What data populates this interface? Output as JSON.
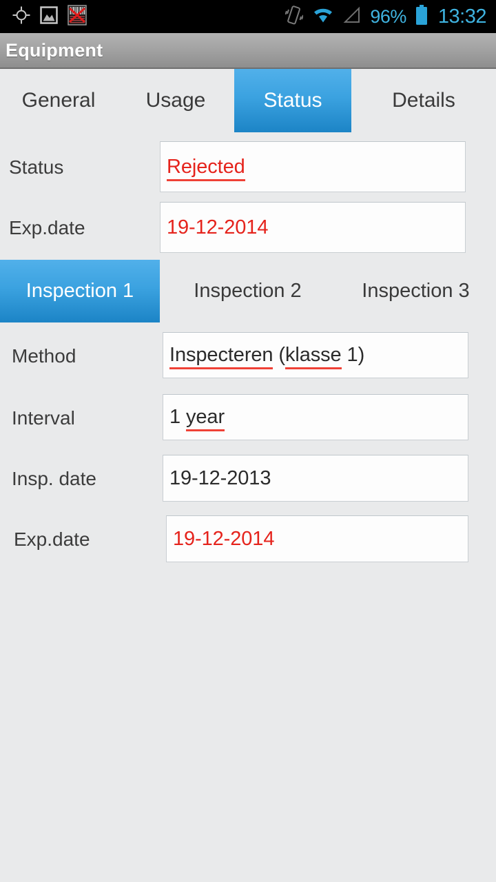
{
  "statusbar": {
    "icons_left": [
      "gps-location-icon",
      "gallery-image-icon",
      "barcode-disabled-icon"
    ],
    "icons_right": [
      "vibrate-icon",
      "wifi-icon",
      "signal-icon",
      "battery-icon"
    ],
    "battery_percent": "96%",
    "clock": "13:32"
  },
  "titlebar": {
    "title": "Equipment"
  },
  "tabs": [
    {
      "label": "General",
      "active": false
    },
    {
      "label": "Usage",
      "active": false
    },
    {
      "label": "Status",
      "active": true
    },
    {
      "label": "Details",
      "active": false
    }
  ],
  "status_section": {
    "status": {
      "label": "Status",
      "value": "Rejected",
      "value_color": "#e5231c",
      "spellcheck_underline": true
    },
    "exp_date": {
      "label": "Exp.date",
      "value": "19-12-2014",
      "value_color": "#e5231c",
      "spellcheck_underline": false
    }
  },
  "inspection_tabs": [
    {
      "label": "Inspection 1",
      "active": true
    },
    {
      "label": "Inspection 2",
      "active": false
    },
    {
      "label": "Inspection 3",
      "active": false
    }
  ],
  "inspection_fields": {
    "method": {
      "label": "Method",
      "value_part1": "Inspecteren",
      "value_part2": " (",
      "value_part3": "klasse",
      "value_part4": " 1)",
      "value_full": "Inspecteren (klasse 1)",
      "value_color": "#2b2b2b"
    },
    "interval": {
      "label": "Interval",
      "value_part1": "1 ",
      "value_part2": "year",
      "value_full": "1 year",
      "value_color": "#2b2b2b"
    },
    "insp_date": {
      "label": "Insp. date",
      "value": "19-12-2013",
      "value_color": "#2b2b2b"
    },
    "exp_date": {
      "label": "Exp.date",
      "value": "19-12-2014",
      "value_color": "#e5231c"
    }
  },
  "colors": {
    "accent_blue": "#1c84c6",
    "tab_blue_light": "#51b0ea",
    "error_red": "#e5231c",
    "spell_underline_red": "#ef4136",
    "page_background": "#e9eaeb",
    "statusbar_background": "#000000",
    "status_text_blue": "#3fb3e0"
  }
}
